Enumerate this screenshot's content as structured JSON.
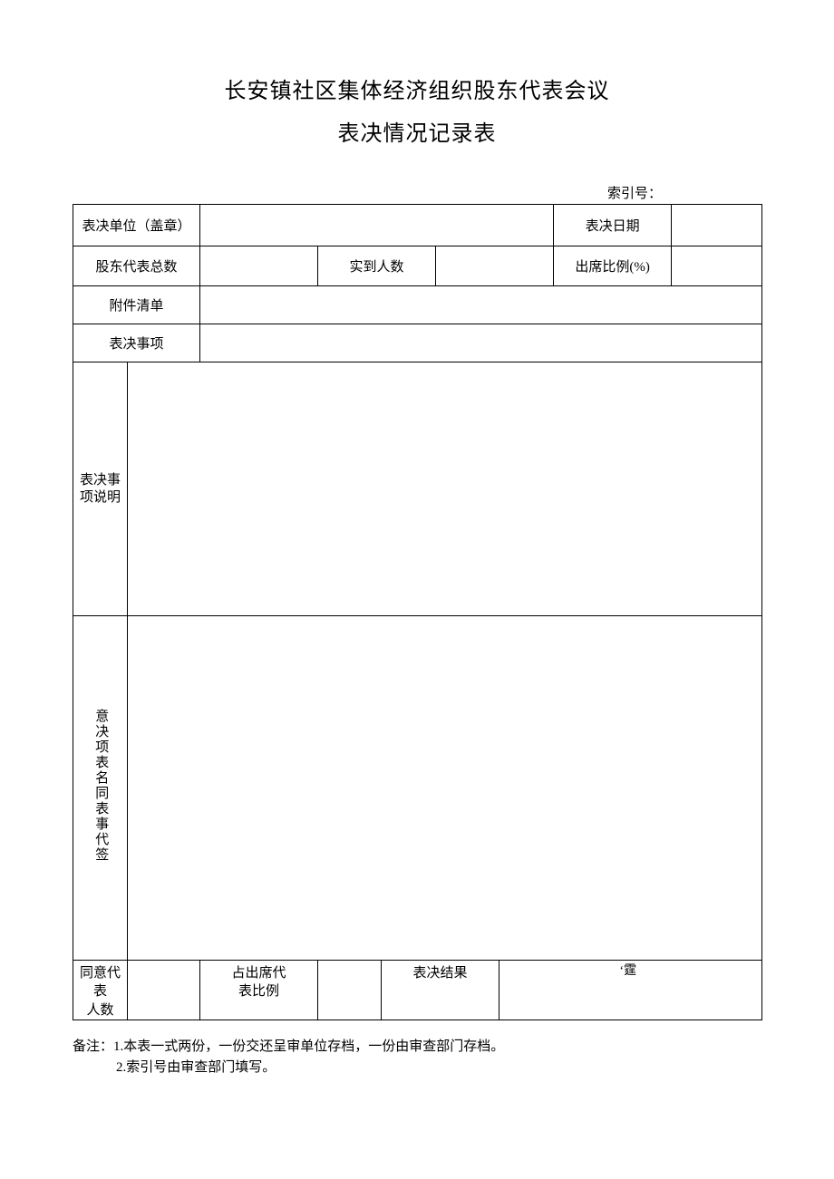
{
  "title_line1": "长安镇社区集体经济组织股东代表会议",
  "title_line2": "表决情况记录表",
  "index_label": "索引号：",
  "row1": {
    "unit_label": "表决单位（盖章）",
    "date_label": "表决日期"
  },
  "row2": {
    "total_label": "股东代表总数",
    "actual_label": "实到人数",
    "ratio_label": "出席比例(%)"
  },
  "row3": {
    "attach_label": "附件清单"
  },
  "row4": {
    "item_label": "表决事项"
  },
  "row5a_label_l1": "表决事",
  "row5a_label_l2": "项说明",
  "row5b_label": "意决项表名同表事代签",
  "row6": {
    "agree_l1": "同意代表",
    "agree_l2": "人数",
    "share_l1": "占出席代",
    "share_l2": "表比例",
    "result_label": "表决结果",
    "result_mark": "‘霆"
  },
  "notes": {
    "prefix": "备注：",
    "n1": "1.本表一式两份，一份交还呈审单位存档，一份由审查部门存档。",
    "n2": "2.索引号由审查部门填写。"
  }
}
